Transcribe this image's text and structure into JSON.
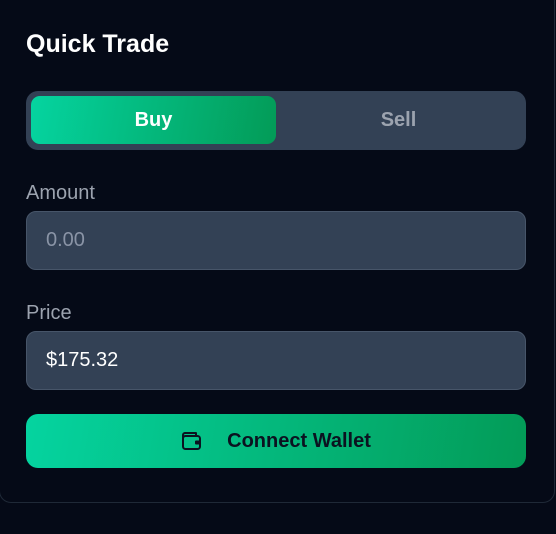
{
  "panel": {
    "title": "Quick Trade"
  },
  "trade_toggle": {
    "buy_label": "Buy",
    "sell_label": "Sell",
    "selected": "Buy"
  },
  "amount": {
    "label": "Amount",
    "placeholder": "0.00",
    "value": ""
  },
  "price": {
    "label": "Price",
    "value": "$175.32"
  },
  "connect": {
    "label": "Connect Wallet",
    "icon": "wallet-icon"
  },
  "colors": {
    "background": "#050a17",
    "surface": "#334155",
    "accent_start": "#05d4a0",
    "accent_end": "#039b57",
    "muted_text": "#9ca3af"
  }
}
